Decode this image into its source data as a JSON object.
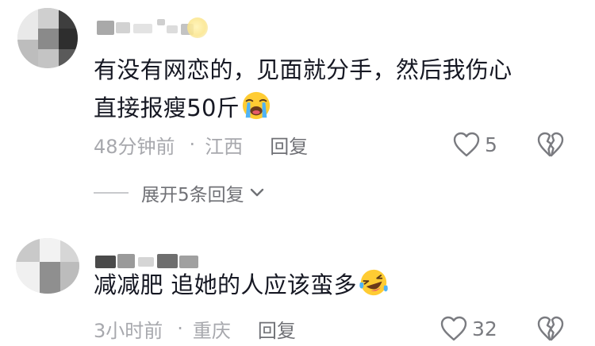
{
  "comments": [
    {
      "username": "",
      "text": "有没有网恋的，见面就分手，然后我伤心直接报瘦50斤",
      "line1": "有没有网恋的，见面就分手，然后我伤心",
      "line2": "直接报瘦50斤",
      "emoji": "loudly-crying-face",
      "time": "48分钟前",
      "separator": "·",
      "location": "江西",
      "reply_label": "回复",
      "likes": "5",
      "expand_label": "展开5条回复"
    },
    {
      "username": "",
      "text": "减减肥 追她的人应该蛮多",
      "emoji": "laughing-tears-face",
      "time": "3小时前",
      "separator": "·",
      "location": "重庆",
      "reply_label": "回复",
      "likes": "32"
    }
  ],
  "colors": {
    "text_primary": "#161823",
    "text_meta": "#a7a8ad",
    "reply": "#707176",
    "icon": "#7a7b80"
  }
}
